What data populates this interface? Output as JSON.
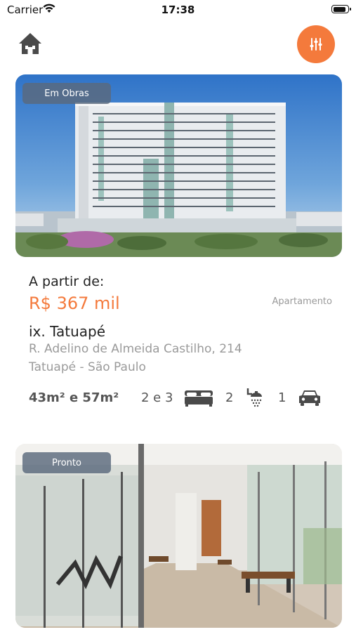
{
  "status_bar": {
    "carrier": "Carrier",
    "time": "17:38"
  },
  "header": {
    "home_icon": "home-icon",
    "filter_icon": "filter-icon",
    "accent": "#f47a3c"
  },
  "listings": [
    {
      "status": "Em Obras",
      "price_label": "A partir de:",
      "price": "R$ 367 mil",
      "type": "Apartamento",
      "name": "ix. Tatuapé",
      "address_line1": "R. Adelino de Almeida Castilho, 214",
      "address_line2": "Tatuapé - São Paulo",
      "area": "43m² e 57m²",
      "bedrooms": "2 e 3",
      "bathrooms": "2",
      "parking": "1"
    },
    {
      "status": "Pronto"
    }
  ]
}
